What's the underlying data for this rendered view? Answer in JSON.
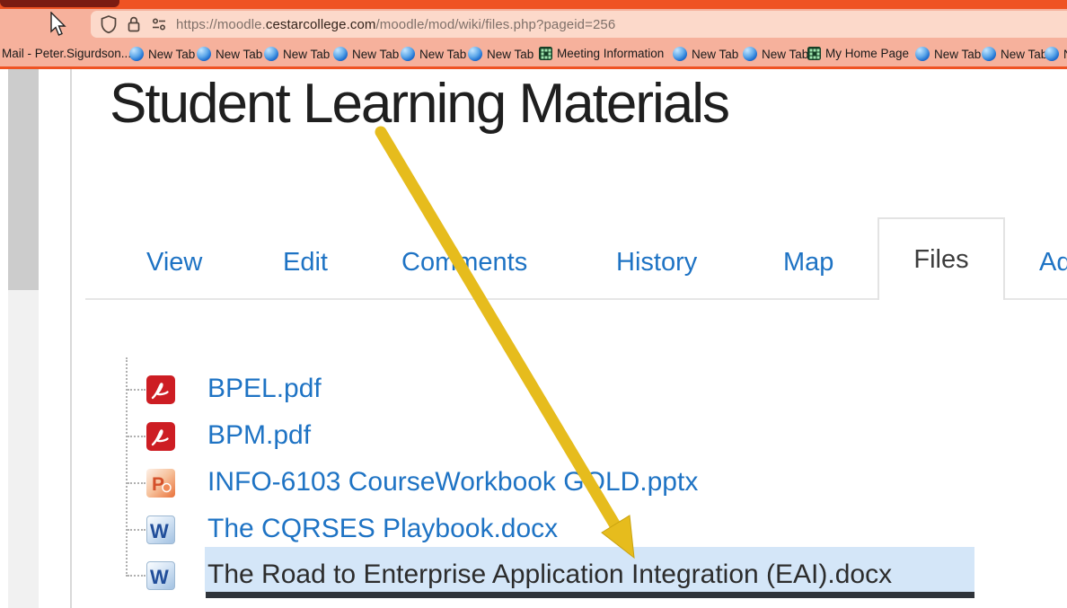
{
  "browser": {
    "url": {
      "prefix": "https://moodle.",
      "domain": "cestarcollege.com",
      "path": "/moodle/mod/wiki/files.php?pageid=256"
    },
    "url_icons": [
      "shield-icon",
      "lock-icon",
      "permissions-icon"
    ],
    "bookmarks": [
      {
        "label": "Mail - Peter.Sigurdson...",
        "icon": "none"
      },
      {
        "label": "New Tab",
        "icon": "blue-globe"
      },
      {
        "label": "New Tab",
        "icon": "blue-globe"
      },
      {
        "label": "New Tab",
        "icon": "blue-globe"
      },
      {
        "label": "New Tab",
        "icon": "blue-globe"
      },
      {
        "label": "New Tab",
        "icon": "blue-globe"
      },
      {
        "label": "New Tab",
        "icon": "blue-globe"
      },
      {
        "label": "Meeting Information",
        "icon": "green-grid"
      },
      {
        "label": "New Tab",
        "icon": "blue-globe"
      },
      {
        "label": "New Tab",
        "icon": "blue-globe"
      },
      {
        "label": "My Home Page",
        "icon": "green-grid"
      },
      {
        "label": "New Tab",
        "icon": "blue-globe"
      },
      {
        "label": "New Tab",
        "icon": "blue-globe"
      },
      {
        "label": "New Tab",
        "icon": "blue-globe",
        "clipped": true
      }
    ]
  },
  "wiki": {
    "title": "Student Learning Materials",
    "tabs": [
      {
        "label": "View",
        "selected": false
      },
      {
        "label": "Edit",
        "selected": false
      },
      {
        "label": "Comments",
        "selected": false
      },
      {
        "label": "History",
        "selected": false
      },
      {
        "label": "Map",
        "selected": false
      },
      {
        "label": "Files",
        "selected": true
      },
      {
        "label": "Ad",
        "selected": false,
        "clipped": true
      }
    ],
    "files": [
      {
        "name": "BPEL.pdf",
        "type": "pdf",
        "selected": false
      },
      {
        "name": "BPM.pdf",
        "type": "pdf",
        "selected": false
      },
      {
        "name": "INFO-6103 CourseWorkbook GOLD.pptx",
        "type": "powerpoint",
        "selected": false
      },
      {
        "name": "The CQRSES Playbook.docx",
        "type": "word",
        "selected": false
      },
      {
        "name": "The Road to Enterprise Application Integration (EAI).docx",
        "type": "word",
        "selected": true
      }
    ]
  },
  "annotation": {
    "type": "arrow",
    "color": "#e6bc1d",
    "points_to": "The Road to Enterprise Application Integration (EAI).docx"
  },
  "colors": {
    "theme_orange": "#ef5323",
    "theme_salmon": "#f6b19c",
    "urlbar_pink": "#fcd9ca",
    "active_tab_maroon": "#7b1c12",
    "link_blue": "#1e73c4",
    "selection_blue": "#d4e6f8",
    "selection_underline": "#2f343a",
    "arrow_gold": "#e6bc1d"
  }
}
